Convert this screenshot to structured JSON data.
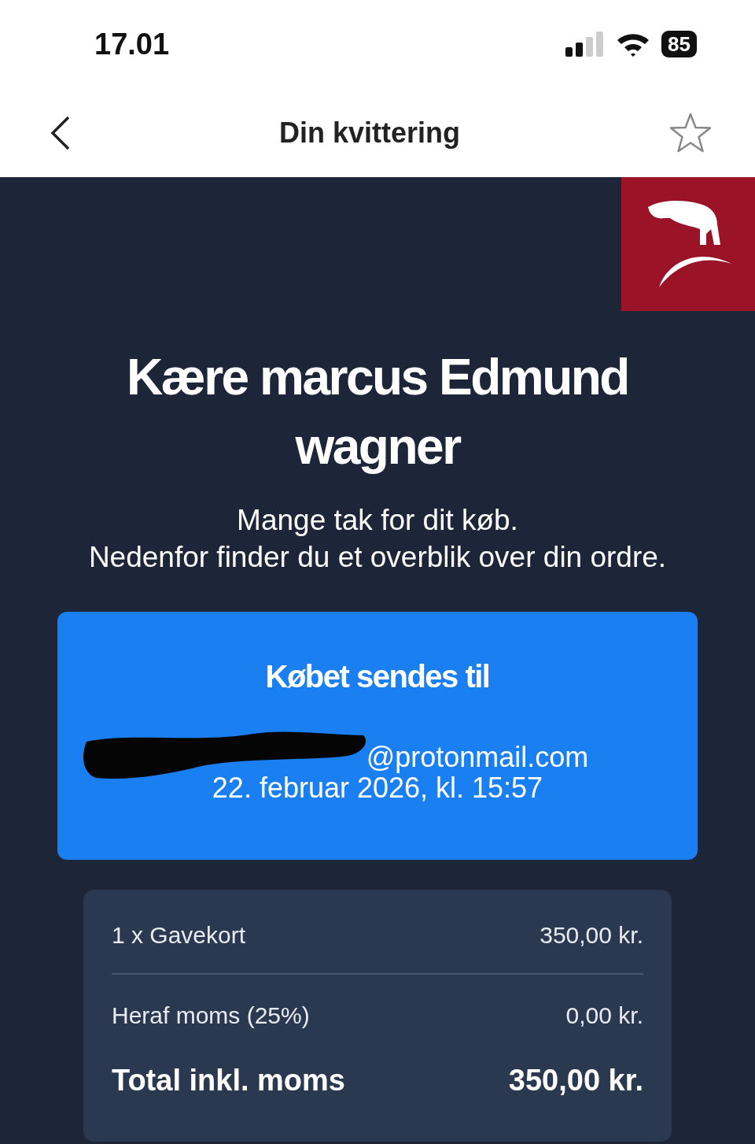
{
  "status_bar": {
    "time": "17.01",
    "battery": "85"
  },
  "nav": {
    "title": "Din kvittering",
    "favorite": false
  },
  "greeting": {
    "title": "Kære marcus Edmund wagner",
    "message": "Mange tak for dit køb.\nNedenfor finder du et overblik over din ordre."
  },
  "delivery": {
    "title": "Købet sendes til",
    "email": "@protonmail.com",
    "date": "22. februar 2026, kl. 15:57"
  },
  "summary": {
    "lines": [
      {
        "kind": "item",
        "label": "1 x Gavekort",
        "amount": "350,00 kr."
      },
      {
        "kind": "tax",
        "label": "Heraf moms (25%)",
        "amount": "0,00 kr."
      },
      {
        "kind": "total",
        "label": "Total inkl. moms",
        "amount": "350,00 kr."
      }
    ]
  }
}
